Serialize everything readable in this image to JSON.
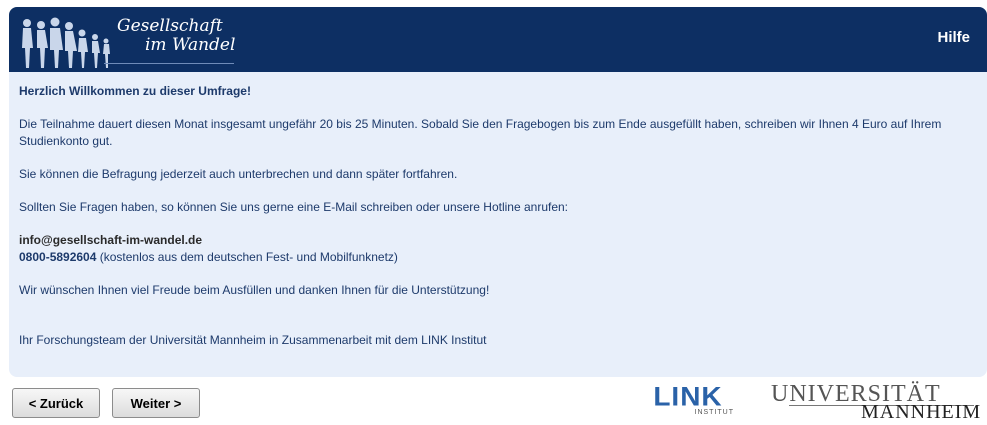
{
  "header": {
    "brand_line1": "Gesellschaft",
    "brand_line2": "im Wandel",
    "help_label": "Hilfe"
  },
  "content": {
    "welcome": "Herzlich Willkommen zu dieser Umfrage!",
    "duration": "Die Teilnahme dauert diesen Monat insgesamt ungefähr 20 bis 25 Minuten. Sobald Sie den Fragebogen bis zum Ende ausgefüllt haben, schreiben wir Ihnen 4 Euro auf Ihrem Studienkonto gut.",
    "pause": "Sie können die Befragung jederzeit auch unterbrechen und dann später fortfahren.",
    "questions": "Sollten Sie Fragen haben, so können Sie uns gerne eine E-Mail schreiben oder unsere Hotline anrufen:",
    "email": "info@gesellschaft-im-wandel.de",
    "phone": "0800-5892604",
    "phone_note": " (kostenlos aus dem deutschen Fest- und Mobilfunknetz)",
    "wish": "Wir wünschen Ihnen viel Freude beim Ausfüllen und danken Ihnen für die Unterstützung!",
    "signature": "Ihr Forschungsteam der Universität Mannheim in Zusammenarbeit mit dem LINK Institut"
  },
  "nav": {
    "back_label": "< Zurück",
    "next_label": "Weiter >"
  },
  "logos": {
    "link_word": "LINK",
    "link_sub": "INSTITUT",
    "uni_line1": "UNIVERSITÄT",
    "uni_line2": "MANNHEIM"
  },
  "colors": {
    "header_bg": "#0d2f63",
    "panel_bg": "#e8effa",
    "text": "#1d3a6b",
    "link_blue": "#2a62a8"
  }
}
